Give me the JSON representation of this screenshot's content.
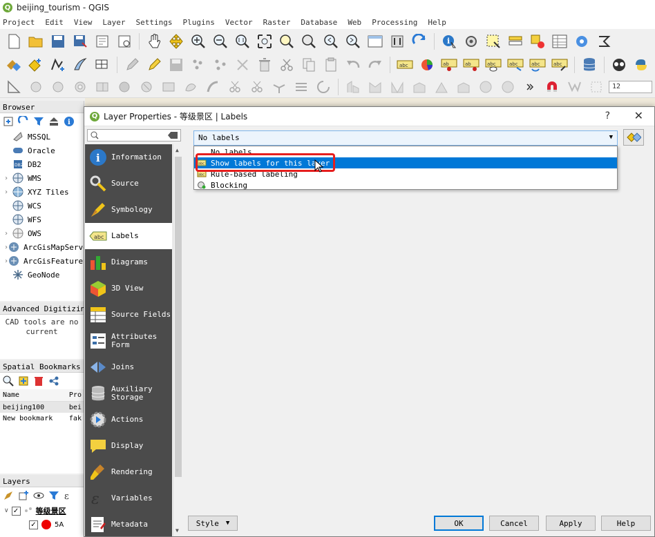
{
  "app": {
    "title": "beijing_tourism - QGIS"
  },
  "menu": [
    "Project",
    "Edit",
    "View",
    "Layer",
    "Settings",
    "Plugins",
    "Vector",
    "Raster",
    "Database",
    "Web",
    "Processing",
    "Help"
  ],
  "toolbar": {
    "zoom_value": "12"
  },
  "browser": {
    "title": "Browser",
    "items": [
      {
        "label": "MSSQL",
        "icon": "mssql-icon",
        "expandable": false
      },
      {
        "label": "Oracle",
        "icon": "oracle-icon",
        "expandable": false
      },
      {
        "label": "DB2",
        "icon": "db2-icon",
        "expandable": false
      },
      {
        "label": "WMS",
        "icon": "wms-globe-icon",
        "expandable": true
      },
      {
        "label": "XYZ Tiles",
        "icon": "xyz-tiles-icon",
        "expandable": true
      },
      {
        "label": "WCS",
        "icon": "wcs-globe-icon",
        "expandable": false
      },
      {
        "label": "WFS",
        "icon": "wfs-globe-icon",
        "expandable": false
      },
      {
        "label": "OWS",
        "icon": "ows-globe-icon",
        "expandable": true
      },
      {
        "label": "ArcGisMapServer",
        "icon": "arcgis-map-icon",
        "expandable": true
      },
      {
        "label": "ArcGisFeatureServer",
        "icon": "arcgis-feature-icon",
        "expandable": true
      },
      {
        "label": "GeoNode",
        "icon": "geonode-icon",
        "expandable": false
      }
    ]
  },
  "advanced_digitizing": {
    "title": "Advanced Digitizing",
    "line1": "CAD tools are no",
    "line2": "current"
  },
  "spatial_bookmarks": {
    "title": "Spatial Bookmarks",
    "columns": [
      "Name",
      "Pro"
    ],
    "rows": [
      {
        "name": "beijing100",
        "project": "bei"
      },
      {
        "name": "New bookmark",
        "project": "fak"
      }
    ]
  },
  "layers": {
    "title": "Layers",
    "group": "等级景区",
    "item": "5A"
  },
  "dialog": {
    "title": "Layer Properties - 等级景区 | Labels",
    "help": "?",
    "close": "✕",
    "search_placeholder": "",
    "nav": [
      {
        "label": "Information",
        "icon": "information-icon"
      },
      {
        "label": "Source",
        "icon": "source-icon"
      },
      {
        "label": "Symbology",
        "icon": "symbology-icon"
      },
      {
        "label": "Labels",
        "icon": "labels-abc-icon",
        "active": true
      },
      {
        "label": "Diagrams",
        "icon": "diagrams-icon"
      },
      {
        "label": "3D View",
        "icon": "3d-view-icon"
      },
      {
        "label": "Source Fields",
        "icon": "source-fields-icon"
      },
      {
        "label": "Attributes Form",
        "icon": "attributes-form-icon"
      },
      {
        "label": "Joins",
        "icon": "joins-icon"
      },
      {
        "label": "Auxiliary Storage",
        "icon": "auxiliary-storage-icon"
      },
      {
        "label": "Actions",
        "icon": "actions-icon"
      },
      {
        "label": "Display",
        "icon": "display-icon"
      },
      {
        "label": "Rendering",
        "icon": "rendering-icon"
      },
      {
        "label": "Variables",
        "icon": "variables-icon"
      },
      {
        "label": "Metadata",
        "icon": "metadata-icon"
      }
    ],
    "mode_combo": {
      "selected": "No labels"
    },
    "mode_options": [
      {
        "label": "No labels",
        "highlighted": false
      },
      {
        "label": "Show labels for this layer",
        "highlighted": true
      },
      {
        "label": "Rule-based labeling",
        "highlighted": false
      },
      {
        "label": "Blocking",
        "highlighted": false
      }
    ],
    "buttons": {
      "style": "Style",
      "ok": "OK",
      "cancel": "Cancel",
      "apply": "Apply",
      "help": "Help"
    }
  },
  "colors": {
    "highlight": "#0078d7",
    "annotation": "#e61e1e",
    "nav_bg": "#4b4b4b",
    "qgis_green": "#6ea83a"
  }
}
